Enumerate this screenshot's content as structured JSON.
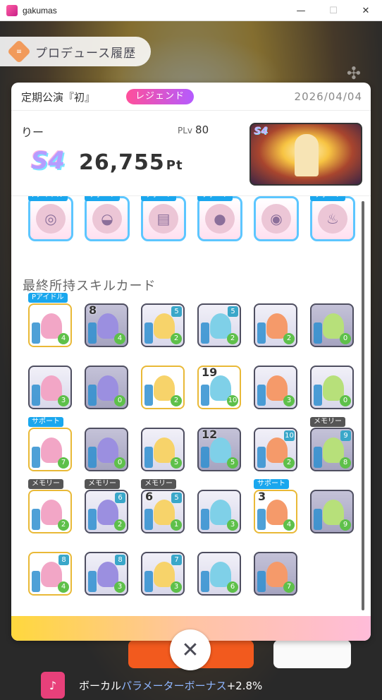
{
  "window": {
    "title": "gakumas",
    "minimize": "—",
    "maximize": "☐",
    "close": "✕"
  },
  "header": {
    "title": "プロデュース履歴",
    "icon": "document-icon"
  },
  "panel": {
    "event_name": "定期公演『初』",
    "badge": "レジェンド",
    "date": "2026/04/04",
    "player_name": "りー",
    "plv_label": "PLv",
    "plv_value": "80",
    "rank": "S4",
    "score": "26,755",
    "score_unit": "Pt",
    "thumb_rank": "S4"
  },
  "items": [
    {
      "tag": "Pアイドル",
      "icon": "earring-icon"
    },
    {
      "tag": "サポート",
      "icon": "bowl-icon"
    },
    {
      "tag": "サポート",
      "icon": "notebook-icon"
    },
    {
      "tag": "サポート",
      "icon": "ball-icon"
    },
    {
      "tag": "",
      "icon": "coin-icon"
    },
    {
      "tag": "サポート",
      "icon": "lamp-icon"
    }
  ],
  "section_title": "最終所持スキルカード",
  "cards": [
    {
      "tag": "Pアイドル",
      "count": "",
      "cost": "",
      "life": "4",
      "style": "gold"
    },
    {
      "tag": "",
      "count": "8",
      "cost": "",
      "life": "4",
      "style": "plain"
    },
    {
      "tag": "",
      "count": "",
      "cost": "5",
      "life": "2",
      "style": "light"
    },
    {
      "tag": "",
      "count": "",
      "cost": "5",
      "life": "2",
      "style": "light"
    },
    {
      "tag": "",
      "count": "",
      "cost": "",
      "life": "2",
      "style": "light"
    },
    {
      "tag": "",
      "count": "",
      "cost": "",
      "life": "0",
      "style": "plain"
    },
    {
      "tag": "",
      "count": "",
      "cost": "",
      "life": "3",
      "style": "light"
    },
    {
      "tag": "",
      "count": "",
      "cost": "",
      "life": "0",
      "style": "plain"
    },
    {
      "tag": "",
      "count": "",
      "cost": "",
      "life": "2",
      "style": "gold"
    },
    {
      "tag": "",
      "count": "19",
      "cost": "",
      "life": "10",
      "style": "gold"
    },
    {
      "tag": "",
      "count": "",
      "cost": "",
      "life": "3",
      "style": "light"
    },
    {
      "tag": "",
      "count": "",
      "cost": "",
      "life": "0",
      "style": "light"
    },
    {
      "tag": "サポート",
      "count": "",
      "cost": "",
      "life": "7",
      "style": "gold"
    },
    {
      "tag": "",
      "count": "",
      "cost": "",
      "life": "0",
      "style": "plain"
    },
    {
      "tag": "",
      "count": "",
      "cost": "",
      "life": "5",
      "style": "light"
    },
    {
      "tag": "",
      "count": "12",
      "cost": "",
      "life": "5",
      "style": "plain"
    },
    {
      "tag": "",
      "count": "",
      "cost": "10",
      "life": "2",
      "style": "light"
    },
    {
      "tag": "メモリー",
      "count": "",
      "cost": "9",
      "life": "8",
      "style": "plain"
    },
    {
      "tag": "メモリー",
      "count": "",
      "cost": "",
      "life": "2",
      "style": "gold"
    },
    {
      "tag": "メモリー",
      "count": "",
      "cost": "6",
      "life": "2",
      "style": "light"
    },
    {
      "tag": "メモリー",
      "count": "6",
      "cost": "5",
      "life": "1",
      "style": "light"
    },
    {
      "tag": "",
      "count": "",
      "cost": "",
      "life": "3",
      "style": "light"
    },
    {
      "tag": "サポート",
      "count": "3",
      "cost": "",
      "life": "4",
      "style": "gold"
    },
    {
      "tag": "",
      "count": "",
      "cost": "",
      "life": "9",
      "style": "plain"
    },
    {
      "tag": "",
      "count": "",
      "cost": "8",
      "life": "4",
      "style": "gold"
    },
    {
      "tag": "",
      "count": "",
      "cost": "8",
      "life": "3",
      "style": "light"
    },
    {
      "tag": "",
      "count": "",
      "cost": "7",
      "life": "3",
      "style": "light"
    },
    {
      "tag": "",
      "count": "",
      "cost": "",
      "life": "6",
      "style": "light"
    },
    {
      "tag": "",
      "count": "",
      "cost": "",
      "life": "7",
      "style": "plain"
    }
  ],
  "bonus": {
    "icon": "microphone-icon",
    "prefix": "ボーカル",
    "highlight": "パラメーター",
    "suffix": "ボーナス",
    "value": "+2.8%"
  },
  "close_label": "✕",
  "colors": {
    "accent_pink": "#ff4f9a",
    "accent_purple": "#b45bff",
    "support_tag": "#1aa7ee",
    "memory_tag": "#555555"
  }
}
